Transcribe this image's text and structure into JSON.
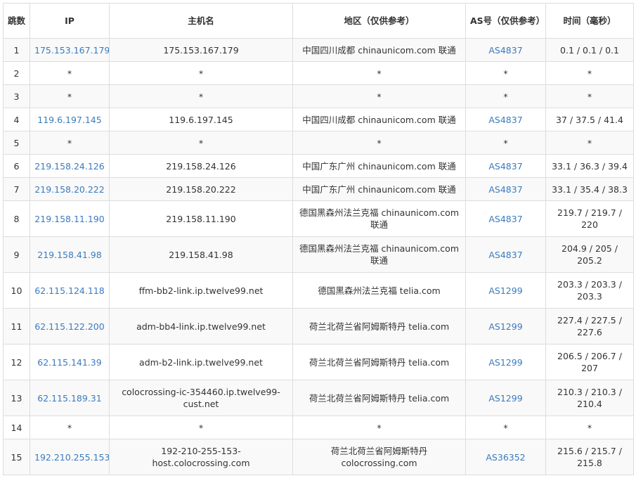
{
  "headers": {
    "hop": "跳数",
    "ip": "IP",
    "host": "主机名",
    "region": "地区（仅供参考）",
    "as": "AS号（仅供参考）",
    "time": "时间（毫秒）"
  },
  "rows": [
    {
      "hop": "1",
      "ip": "175.153.167.179",
      "host": "175.153.167.179",
      "region": "中国四川成都 chinaunicom.com 联通",
      "as": "AS4837",
      "time": "0.1 / 0.1 / 0.1"
    },
    {
      "hop": "2",
      "ip": "*",
      "host": "*",
      "region": "*",
      "as": "*",
      "time": "*"
    },
    {
      "hop": "3",
      "ip": "*",
      "host": "*",
      "region": "*",
      "as": "*",
      "time": "*"
    },
    {
      "hop": "4",
      "ip": "119.6.197.145",
      "host": "119.6.197.145",
      "region": "中国四川成都 chinaunicom.com 联通",
      "as": "AS4837",
      "time": "37 / 37.5 / 41.4"
    },
    {
      "hop": "5",
      "ip": "*",
      "host": "*",
      "region": "*",
      "as": "*",
      "time": "*"
    },
    {
      "hop": "6",
      "ip": "219.158.24.126",
      "host": "219.158.24.126",
      "region": "中国广东广州 chinaunicom.com 联通",
      "as": "AS4837",
      "time": "33.1 / 36.3 / 39.4"
    },
    {
      "hop": "7",
      "ip": "219.158.20.222",
      "host": "219.158.20.222",
      "region": "中国广东广州 chinaunicom.com 联通",
      "as": "AS4837",
      "time": "33.1 / 35.4 / 38.3"
    },
    {
      "hop": "8",
      "ip": "219.158.11.190",
      "host": "219.158.11.190",
      "region": "德国黑森州法兰克福 chinaunicom.com 联通",
      "as": "AS4837",
      "time": "219.7 / 219.7 / 220"
    },
    {
      "hop": "9",
      "ip": "219.158.41.98",
      "host": "219.158.41.98",
      "region": "德国黑森州法兰克福 chinaunicom.com 联通",
      "as": "AS4837",
      "time": "204.9 / 205 / 205.2"
    },
    {
      "hop": "10",
      "ip": "62.115.124.118",
      "host": "ffm-bb2-link.ip.twelve99.net",
      "region": "德国黑森州法兰克福 telia.com",
      "as": "AS1299",
      "time": "203.3 / 203.3 / 203.3"
    },
    {
      "hop": "11",
      "ip": "62.115.122.200",
      "host": "adm-bb4-link.ip.twelve99.net",
      "region": "荷兰北荷兰省阿姆斯特丹 telia.com",
      "as": "AS1299",
      "time": "227.4 / 227.5 / 227.6"
    },
    {
      "hop": "12",
      "ip": "62.115.141.39",
      "host": "adm-b2-link.ip.twelve99.net",
      "region": "荷兰北荷兰省阿姆斯特丹 telia.com",
      "as": "AS1299",
      "time": "206.5 / 206.7 / 207"
    },
    {
      "hop": "13",
      "ip": "62.115.189.31",
      "host": "colocrossing-ic-354460.ip.twelve99-cust.net",
      "region": "荷兰北荷兰省阿姆斯特丹 telia.com",
      "as": "AS1299",
      "time": "210.3 / 210.3 / 210.4"
    },
    {
      "hop": "14",
      "ip": "*",
      "host": "*",
      "region": "*",
      "as": "*",
      "time": "*"
    },
    {
      "hop": "15",
      "ip": "192.210.255.153",
      "host": "192-210-255-153-host.colocrossing.com",
      "region": "荷兰北荷兰省阿姆斯特丹 colocrossing.com",
      "as": "AS36352",
      "time": "215.6 / 215.7 / 215.8"
    }
  ],
  "colors": {
    "link": "#3a7bbf",
    "text": "#333333",
    "border": "#dddddd",
    "stripe": "#f9f9f9"
  }
}
